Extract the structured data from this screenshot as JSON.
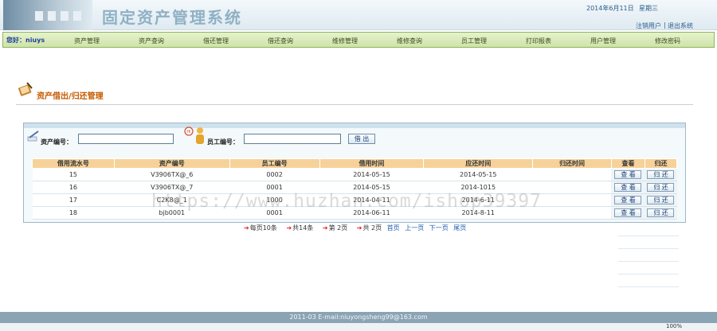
{
  "header": {
    "title": "固定资产管理系统",
    "date": "2014年6月11日",
    "weekday": "星期三",
    "switch_user": "注销用户",
    "separator": "|",
    "logout": "退出系统"
  },
  "nav": {
    "greeting": "您好：niuys",
    "items": [
      "资产管理",
      "资产查询",
      "借还管理",
      "借还查询",
      "维修管理",
      "维修查询",
      "员工管理",
      "打印报表",
      "用户管理",
      "修改密码"
    ]
  },
  "page": {
    "title": "资产借出/归还管理"
  },
  "form": {
    "asset_label": "资产编号：",
    "asset_value": "",
    "employee_label": "员工编号：",
    "employee_value": "",
    "borrow_button": "借 出"
  },
  "table": {
    "headers": [
      "借用流水号",
      "资产编号",
      "员工编号",
      "借用时间",
      "应还时间",
      "归还时间",
      "查看",
      "归还"
    ],
    "view_label": "查 看",
    "return_label": "归 还",
    "rows": [
      [
        "15",
        "V3906TX@_6",
        "0002",
        "2014-05-15",
        "2014-05-15",
        ""
      ],
      [
        "16",
        "V3906TX@_7",
        "0001",
        "2014-05-15",
        "2014-1015",
        ""
      ],
      [
        "17",
        "C2K8@_1",
        "1000",
        "2014-04-11",
        "2014-6-11",
        ""
      ],
      [
        "18",
        "bjb0001",
        "0001",
        "2014-06-11",
        "2014-8-11",
        ""
      ]
    ]
  },
  "pager": {
    "per_page": "每页10条",
    "total": "共14条",
    "current": "第 2页",
    "pages": "共 2页",
    "first": "首页",
    "prev": "上一页",
    "next": "下一页",
    "last": "尾页"
  },
  "watermark": "https://www.huzhan.com/ishop39397",
  "footer": {
    "text": "2011-03 E-mail:niuyongsheng99@163.com",
    "zoom": "100%"
  }
}
